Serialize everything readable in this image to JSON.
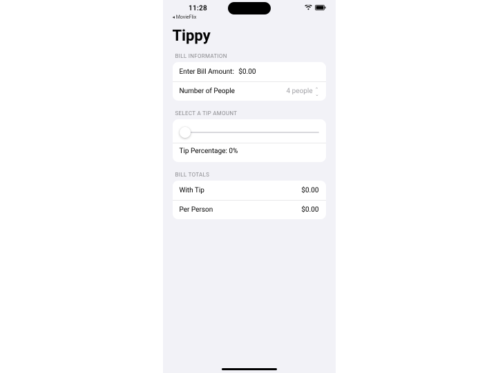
{
  "status": {
    "time": "11:28",
    "back_app": "◂ MovieFlix"
  },
  "app": {
    "title": "Tippy"
  },
  "sections": {
    "bill_info_header": "BILL INFORMATION",
    "tip_header": "SELECT A TIP AMOUNT",
    "totals_header": "BILL TOTALS"
  },
  "bill_info": {
    "enter_label": "Enter Bill Amount:",
    "enter_value": "$0.00",
    "people_label": "Number of People",
    "people_value": "4 people"
  },
  "tip": {
    "percentage_label": "Tip Percentage: 0%",
    "slider_value": 0
  },
  "totals": {
    "with_tip_label": "With Tip",
    "with_tip_value": "$0.00",
    "per_person_label": "Per Person",
    "per_person_value": "$0.00"
  }
}
